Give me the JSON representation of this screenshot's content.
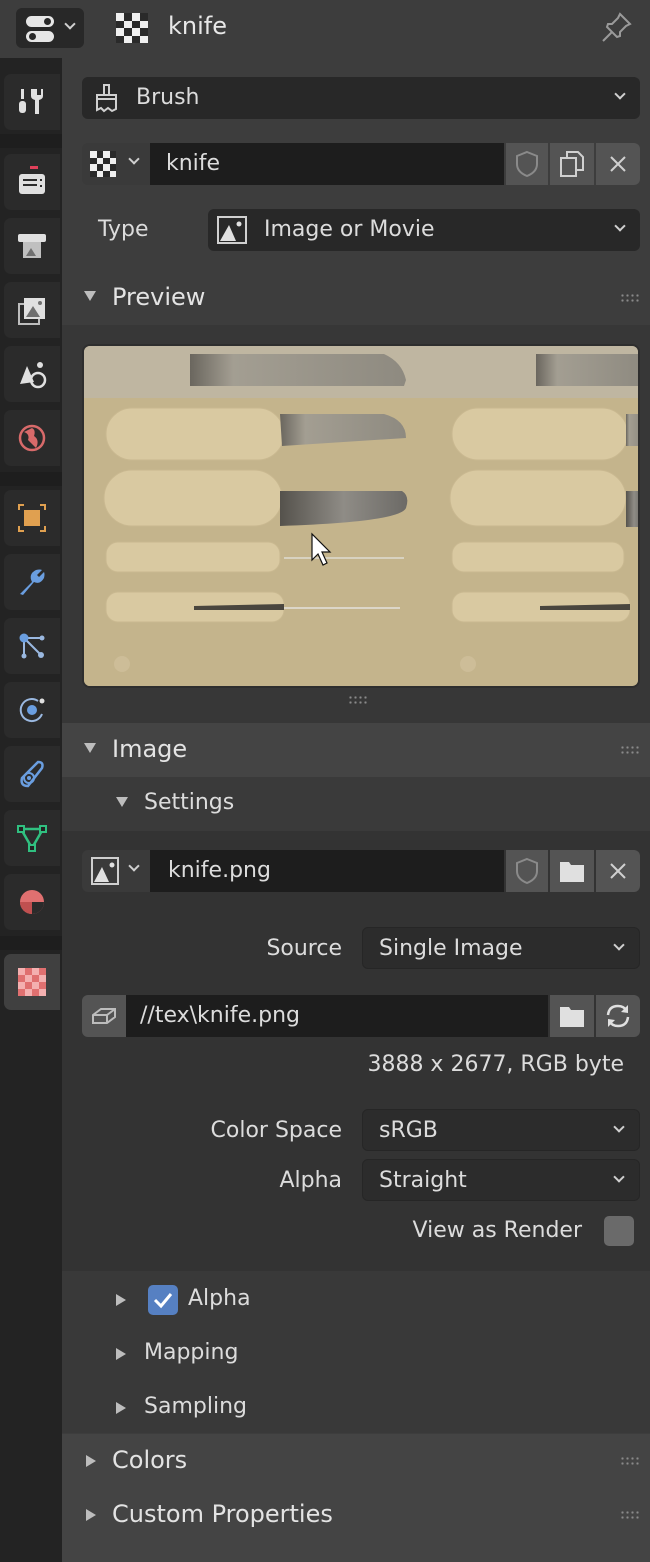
{
  "header": {
    "title": "knife",
    "editor_type_icon": "properties-editor-icon",
    "datablock_icon": "texture-checker-icon",
    "pin_icon": "pin-icon"
  },
  "sidebar": {
    "tabs": [
      {
        "name": "tool",
        "icon": "tool-wrench-screwdriver-icon",
        "color": "#e0e0e0"
      },
      {
        "name": "render",
        "icon": "camera-render-icon",
        "color": "#e0e0e0"
      },
      {
        "name": "output",
        "icon": "printer-output-icon",
        "color": "#e0e0e0"
      },
      {
        "name": "view-layer",
        "icon": "image-stack-icon",
        "color": "#e0e0e0"
      },
      {
        "name": "scene",
        "icon": "scene-icon",
        "color": "#e0e0e0"
      },
      {
        "name": "world",
        "icon": "world-globe-icon",
        "color": "#d86a6a"
      },
      {
        "name": "object",
        "icon": "object-square-icon",
        "color": "#e0a050"
      },
      {
        "name": "modifiers",
        "icon": "wrench-icon",
        "color": "#6a9ee0"
      },
      {
        "name": "particles",
        "icon": "particles-icon",
        "color": "#6a9ee0"
      },
      {
        "name": "physics",
        "icon": "physics-orbit-icon",
        "color": "#6a9ee0"
      },
      {
        "name": "constraints",
        "icon": "constraint-icon",
        "color": "#6a9ee0"
      },
      {
        "name": "data",
        "icon": "mesh-triangle-icon",
        "color": "#30c080"
      },
      {
        "name": "material",
        "icon": "material-sphere-icon",
        "color": "#e07070"
      },
      {
        "name": "texture",
        "icon": "texture-checker-icon",
        "color": "#e07070",
        "active": true
      }
    ]
  },
  "context": {
    "selector_label": "Brush",
    "selector_icon": "brush-icon"
  },
  "texture_block": {
    "name": "knife",
    "browse_icon": "texture-checker-icon",
    "fake_user_icon": "shield-icon",
    "duplicate_icon": "duplicate-icon",
    "unlink_icon": "close-icon"
  },
  "type_row": {
    "label": "Type",
    "value": "Image or Movie",
    "icon": "image-icon"
  },
  "panels": {
    "preview": {
      "title": "Preview",
      "expanded": true
    },
    "image": {
      "title": "Image",
      "expanded": true,
      "settings": {
        "title": "Settings",
        "expanded": true,
        "image_name": "knife.png",
        "source_label": "Source",
        "source_value": "Single Image",
        "filepath": "//tex\\knife.png",
        "info": "3888 x 2677,  RGB byte",
        "color_space_label": "Color Space",
        "color_space_value": "sRGB",
        "alpha_label": "Alpha",
        "alpha_value": "Straight",
        "view_as_render_label": "View as Render",
        "view_as_render_checked": false
      },
      "subpanels": [
        {
          "title": "Alpha",
          "expanded": false,
          "has_checkbox": true,
          "checked": true
        },
        {
          "title": "Mapping",
          "expanded": false
        },
        {
          "title": "Sampling",
          "expanded": false
        }
      ]
    },
    "colors": {
      "title": "Colors",
      "expanded": false
    },
    "custom_properties": {
      "title": "Custom Properties",
      "expanded": false
    }
  },
  "colors": {
    "accent": "#5680c2",
    "panel_bg": "#3d3d3d",
    "field_bg": "#282828"
  }
}
